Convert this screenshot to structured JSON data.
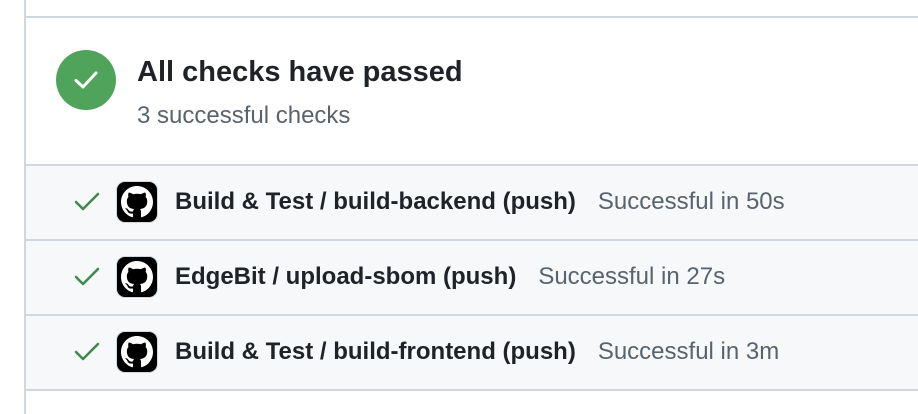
{
  "summary": {
    "title": "All checks have passed",
    "subtitle": "3 successful checks",
    "status_icon": "check-circle-icon",
    "status_color": "#4fa35a"
  },
  "checks": [
    {
      "name": "Build & Test / build-backend (push)",
      "status": "Successful in 50s",
      "icon": "github-icon"
    },
    {
      "name": "EdgeBit / upload-sbom (push)",
      "status": "Successful in 27s",
      "icon": "github-icon"
    },
    {
      "name": "Build & Test / build-frontend (push)",
      "status": "Successful in 3m",
      "icon": "github-icon"
    }
  ],
  "colors": {
    "success_green": "#4fa35a",
    "check_green": "#3d8a4b",
    "muted_text": "#59636e",
    "row_background": "#f6f8fa",
    "border": "#d0d7de"
  }
}
